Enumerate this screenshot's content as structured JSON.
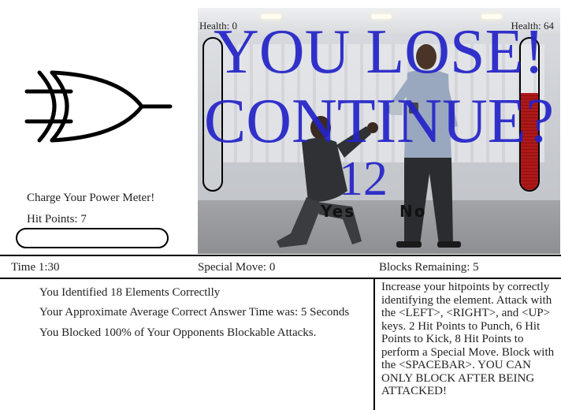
{
  "left_panel": {
    "gate_icon": "or-gate-icon",
    "charge_label": "Charge Your Power Meter!",
    "hit_points_label": "Hit Points: 7",
    "power_meter_level": 0
  },
  "arena": {
    "p1_health_label": "Health: 0",
    "p2_health_label": "Health: 64",
    "p1_health_fraction": 0,
    "p2_health_fraction": 0.64,
    "lose_text": "YOU LOSE!",
    "continue_text": "CONTINUE?",
    "countdown": "12",
    "yes_label": "Yes",
    "no_label": "No",
    "overlay_color": "#2424c8",
    "health_bar_color": "#b01818"
  },
  "status_bar": {
    "time": "Time  1:30",
    "special_move": "Special Move: 0",
    "blocks_remaining": "Blocks Remaining: 5"
  },
  "results": {
    "line1": "You Identified 18 Elements Correctlly",
    "line2": "Your Approximate Average Correct Answer Time was: 5 Seconds",
    "line3": "You Blocked 100% of Your Opponents Blockable Attacks."
  },
  "instructions": "Increase your hitpoints by correctly identifying the element. Attack with the <LEFT>, <RIGHT>, and <UP> keys. 2 Hit Points to Punch, 6 Hit Points to Kick, 8 Hit Points to perform a Special Move. Block with the <SPACEBAR>. YOU CAN ONLY BLOCK AFTER BEING ATTACKED!"
}
